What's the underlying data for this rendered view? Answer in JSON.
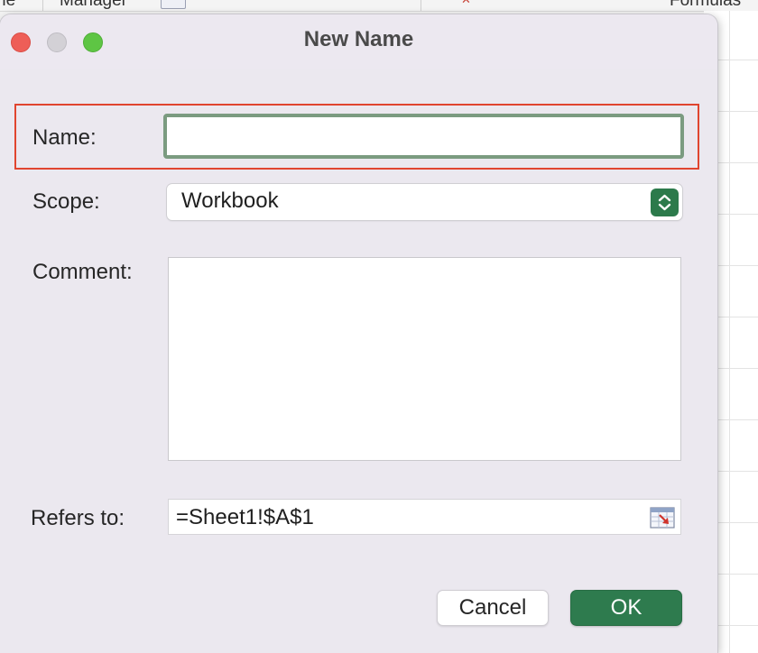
{
  "background": {
    "toolbar_items": [
      "ne",
      "Manager",
      "Formulas"
    ]
  },
  "dialog": {
    "title": "New Name",
    "name": {
      "label": "Name:",
      "value": ""
    },
    "scope": {
      "label": "Scope:",
      "value": "Workbook"
    },
    "comment": {
      "label": "Comment:",
      "value": ""
    },
    "refers_to": {
      "label": "Refers to:",
      "value": "=Sheet1!$A$1"
    },
    "buttons": {
      "cancel": "Cancel",
      "ok": "OK"
    }
  },
  "colors": {
    "accent_green": "#2e7b4e",
    "highlight_red": "#e0452f",
    "dialog_background": "#ebe8ef"
  }
}
